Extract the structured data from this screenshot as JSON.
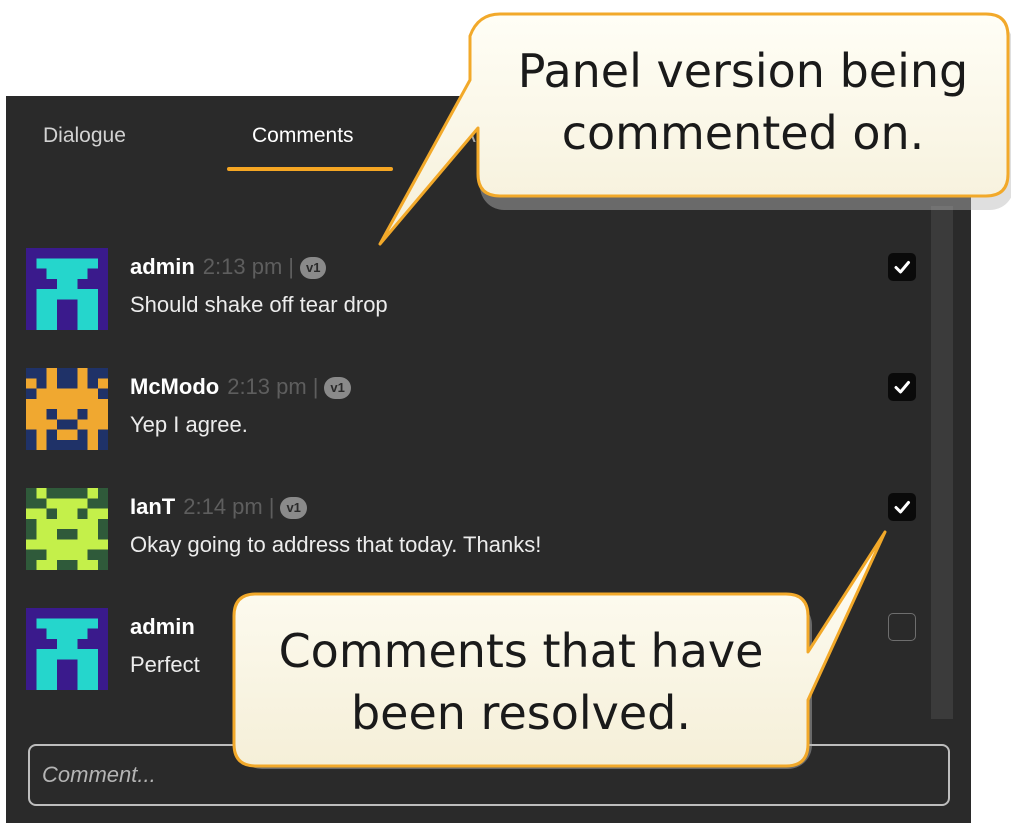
{
  "tabs": [
    {
      "label": "Dialogue",
      "active": false
    },
    {
      "label": "Comments",
      "active": true
    }
  ],
  "accent_color": "#f5a623",
  "comments": [
    {
      "author": "admin",
      "time": "2:13 pm",
      "separator": "|",
      "version": "v1",
      "text": "Should shake off tear drop",
      "resolved": true,
      "avatar_icon": "robot-avatar-icon"
    },
    {
      "author": "McModo",
      "time": "2:13 pm",
      "separator": "|",
      "version": "v1",
      "text": "Yep I agree.",
      "resolved": true,
      "avatar_icon": "space-invader-avatar-icon"
    },
    {
      "author": "IanT",
      "time": "2:14 pm",
      "separator": "|",
      "version": "v1",
      "text": "Okay going to address that today. Thanks!",
      "resolved": true,
      "avatar_icon": "alien-bug-avatar-icon"
    },
    {
      "author": "admin",
      "time": "",
      "separator": "",
      "version": "",
      "text": "Perfect",
      "resolved": false,
      "avatar_icon": "robot-avatar-icon"
    }
  ],
  "comment_input": {
    "placeholder": "Comment..."
  },
  "callouts": {
    "version": {
      "line1": "Panel version being",
      "line2": "commented on."
    },
    "resolved": {
      "line1": "Comments that have",
      "line2": "been resolved."
    }
  }
}
